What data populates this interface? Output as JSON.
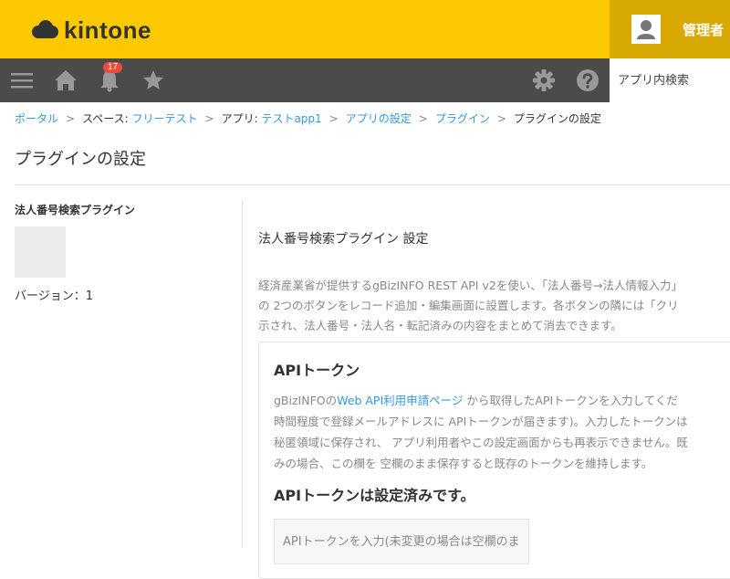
{
  "header": {
    "logo_text": "kintone",
    "user_name": "管理者"
  },
  "nav": {
    "notification_count": "17",
    "search_placeholder": "アプリ内検索"
  },
  "breadcrumb": {
    "portal": "ポータル",
    "space_prefix": "スペース: ",
    "space_name": "フリーテスト",
    "app_prefix": "アプリ: ",
    "app_name": "テストapp1",
    "app_settings": "アプリの設定",
    "plugins": "プラグイン",
    "current": "プラグインの設定",
    "separator": ">"
  },
  "page": {
    "title": "プラグインの設定"
  },
  "sidebar": {
    "plugin_name": "法人番号検索プラグイン",
    "version": "バージョン：1"
  },
  "settings": {
    "title": "法人番号検索プラグイン 設定",
    "description_lines": [
      "経済産業省が提供するgBizINFO REST API v2を使い、「法人番号→法人情報入力」",
      "の 2つのボタンをレコード追加・編集画面に設置します。各ボタンの隣には「クリ",
      "示され、法人番号・法人名・転記済みの内容をまとめて消去できます。"
    ]
  },
  "api_panel": {
    "heading": "APIトークン",
    "desc_prefix": "gBizINFOの",
    "desc_link": "Web API利用申請ページ",
    "desc_line1_suffix": " から取得したAPIトークンを入力してくだ",
    "desc_lines": [
      "時間程度で登録メールアドレスに APIトークンが届きます)。入力したトークンは",
      "秘匿領域に保存され、 アプリ利用者やこの設定画面からも再表示できません。既",
      "みの場合、この欄を 空欄のまま保存すると既存のトークンを維持します。"
    ],
    "status": "APIトークンは設定済みです。",
    "input_placeholder": "APIトークンを入力(未変更の場合は空欄のまま)"
  }
}
